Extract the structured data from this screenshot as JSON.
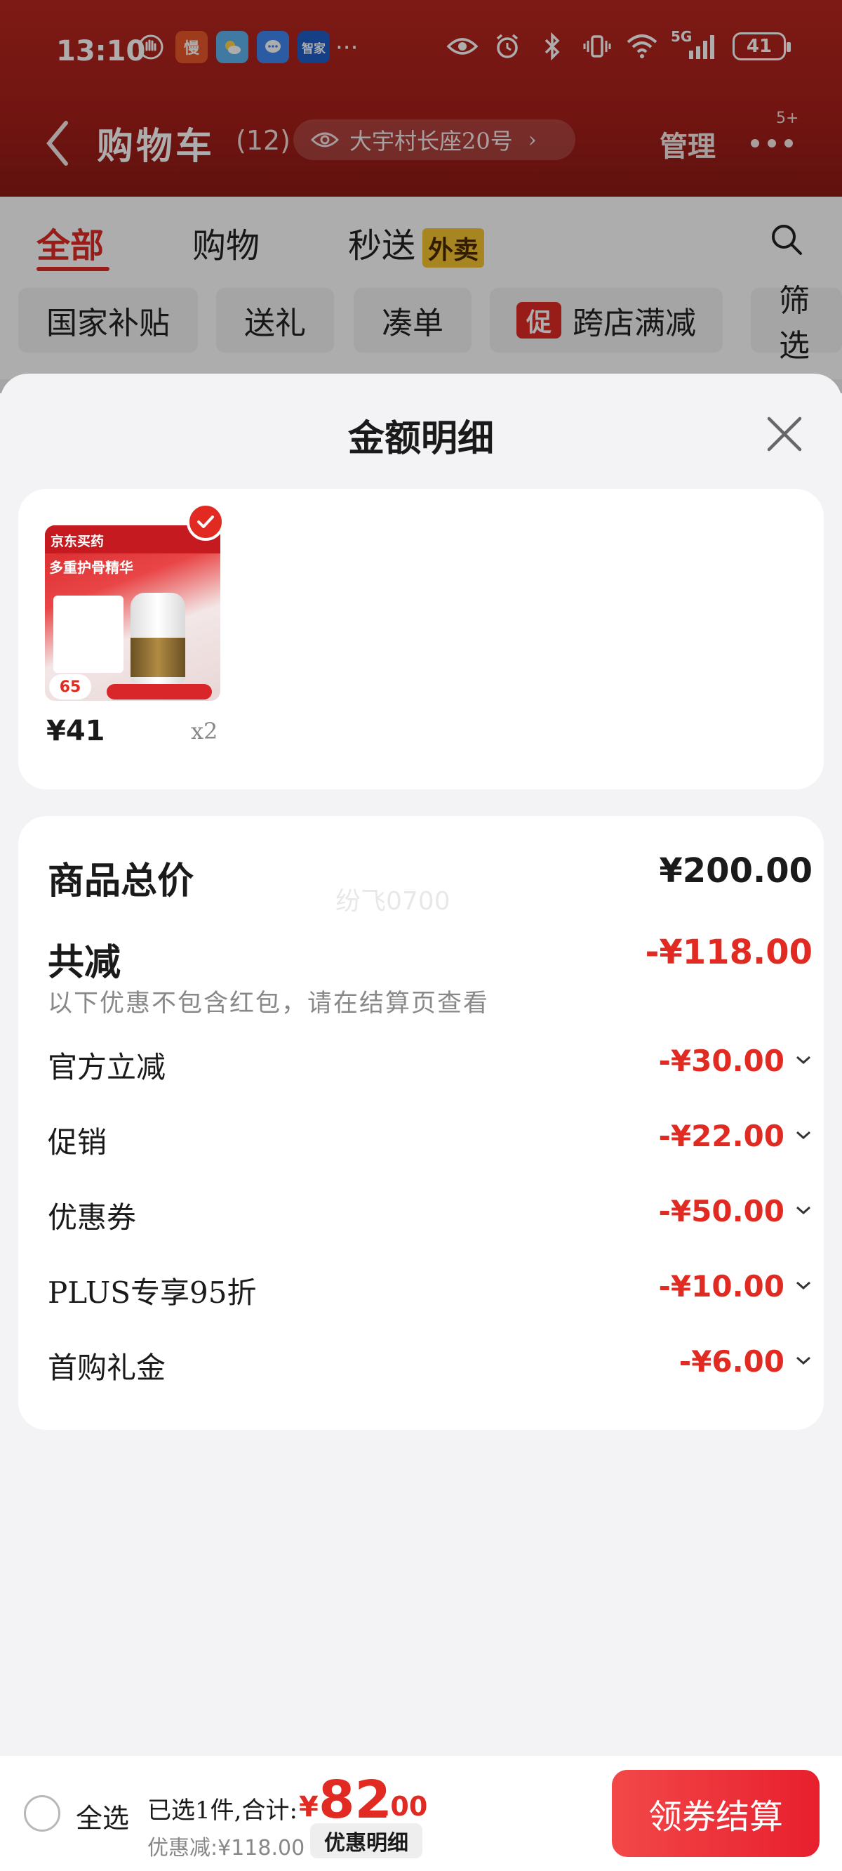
{
  "status_bar": {
    "time": "13:10",
    "apps": [
      {
        "icon": "hand-icon",
        "text": ""
      },
      {
        "icon": "app-man-icon",
        "text": "慢"
      },
      {
        "icon": "weather-icon",
        "text": ""
      },
      {
        "icon": "message-icon",
        "text": ""
      },
      {
        "icon": "smarthome-icon",
        "text": "智家"
      }
    ],
    "overflow": "···",
    "signal": "5G",
    "battery": "41"
  },
  "header": {
    "title": "购物车",
    "count": "(12)",
    "address": "大宇村长座20号",
    "manage": "管理",
    "badge": "5+"
  },
  "tabs": {
    "all": "全部",
    "shopping": "购物",
    "express": "秒送",
    "express_badge": "外卖"
  },
  "filters": {
    "subsidy": "国家补贴",
    "gift": "送礼",
    "bundle": "凑单",
    "promo_tag": "促",
    "cross_store": "跨店满减",
    "filter": "筛选"
  },
  "sheet": {
    "title": "金额明细",
    "product": {
      "price": "¥41",
      "qty": "x2",
      "thumb_brand": "京东买药",
      "thumb_title": "多重护骨精华",
      "thumb_price": "65"
    },
    "total_label": "商品总价",
    "total_value": "¥200.00",
    "watermark": "纷飞0700",
    "reduce_label": "共减",
    "reduce_value": "-¥118.00",
    "reduce_note": "以下优惠不包含红包，请在结算页查看",
    "lines": [
      {
        "label": "官方立减",
        "value": "-¥30.00"
      },
      {
        "label": "促销",
        "value": "-¥22.00"
      },
      {
        "label": "优惠券",
        "value": "-¥50.00"
      },
      {
        "label": "PLUS专享95折",
        "value": "-¥10.00"
      },
      {
        "label": "首购礼金",
        "value": "-¥6.00"
      }
    ]
  },
  "bottom_bar": {
    "select_all": "全选",
    "summary": "已选1件,合计:",
    "symbol": "¥",
    "amount_int": "82",
    "amount_dec": ".00",
    "discount": "优惠减:¥118.00",
    "discount_btn": "优惠明细",
    "checkout": "领券结算"
  },
  "colors": {
    "brand_red": "#e02a22",
    "header_red": "#a71f1a",
    "badge_yellow": "#f6c430"
  }
}
